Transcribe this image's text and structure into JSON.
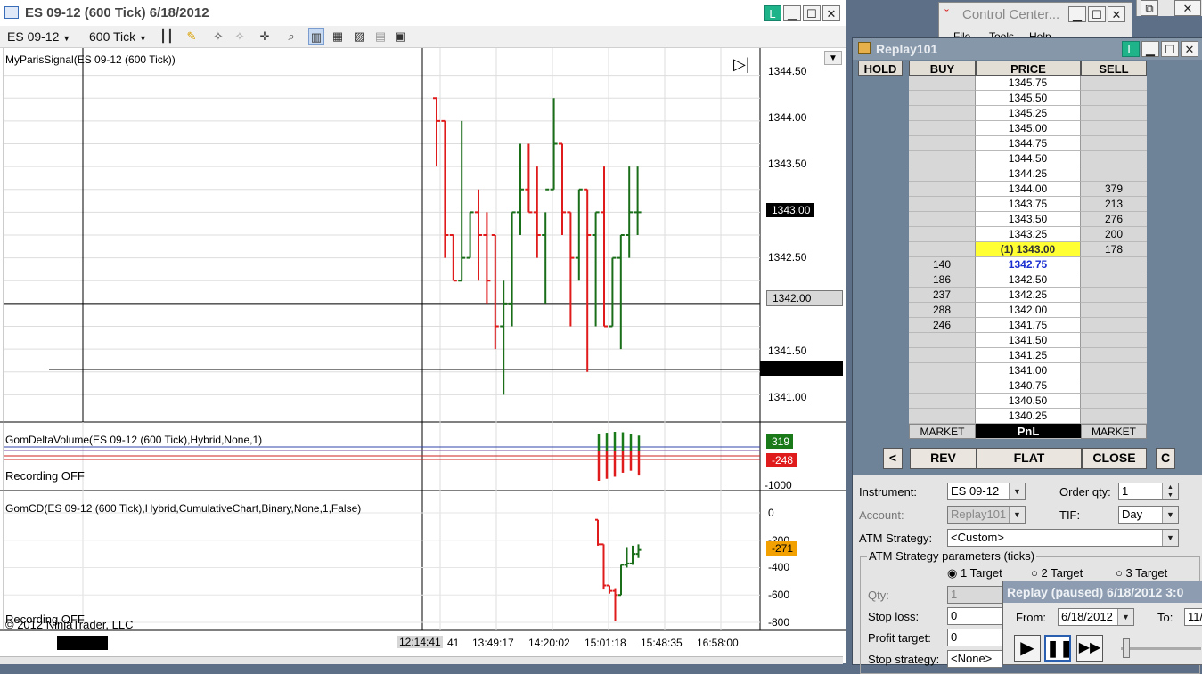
{
  "chart_window": {
    "title": "ES 09-12  (600 Tick)  6/18/2012",
    "toolbar": {
      "instrument": "ES 09-12",
      "period": "600 Tick"
    },
    "panel1_label": "MyParisSignal(ES 09-12 (600 Tick))",
    "panel2_label": "GomDeltaVolume(ES 09-12 (600 Tick),Hybrid,None,1)",
    "panel2_status": "Recording OFF",
    "panel3_label": "GomCD(ES  09-12  (600  Tick),Hybrid,CumulativeChart,Binary,None,1,False)",
    "panel3_status": "Recording OFF",
    "copyright": "© 2012 NinjaTrader, LLC",
    "price_ticks": [
      "1344.50",
      "1344.00",
      "1343.50",
      "1342.50",
      "1341.50",
      "1341.00"
    ],
    "last_price_flag": "1343.00",
    "line_price_flag": "1342.00",
    "delta_flags": {
      "pos": "319",
      "neg": "-248",
      "scale": "-1000"
    },
    "cd_ticks": [
      "0",
      "-200",
      "-400",
      "-600",
      "-800"
    ],
    "cd_flag": "-271",
    "time_ticks": [
      "12:14:41",
      "41",
      "13:49:17",
      "14:20:02",
      "15:01:18",
      "15:48:35",
      "16:58:00"
    ],
    "colors": {
      "up": "#1a6e1a",
      "down": "#e01b1b",
      "last_flag": "#000000",
      "delta_pos": "#1a7a1a",
      "delta_neg": "#e01b1b",
      "cd_flag": "#f2a100"
    }
  },
  "chart_data": [
    {
      "type": "ohlc",
      "series": [
        {
          "o": 1344.25,
          "h": 1344.25,
          "l": 1343.5,
          "c": 1344.0
        },
        {
          "o": 1344.0,
          "h": 1344.0,
          "l": 1342.5,
          "c": 1342.75
        },
        {
          "o": 1342.75,
          "h": 1342.75,
          "l": 1342.25,
          "c": 1342.25
        },
        {
          "o": 1342.25,
          "h": 1344.0,
          "l": 1342.25,
          "c": 1342.5
        },
        {
          "o": 1342.5,
          "h": 1343.0,
          "l": 1342.5,
          "c": 1343.0
        },
        {
          "o": 1343.0,
          "h": 1343.25,
          "l": 1342.25,
          "c": 1342.75
        },
        {
          "o": 1342.75,
          "h": 1343.0,
          "l": 1342.0,
          "c": 1342.25
        },
        {
          "o": 1342.75,
          "h": 1342.75,
          "l": 1341.5,
          "c": 1341.75
        },
        {
          "o": 1341.75,
          "h": 1342.25,
          "l": 1341.0,
          "c": 1342.0
        },
        {
          "o": 1342.0,
          "h": 1343.0,
          "l": 1341.75,
          "c": 1343.0
        },
        {
          "o": 1343.0,
          "h": 1343.75,
          "l": 1342.75,
          "c": 1343.25
        },
        {
          "o": 1343.25,
          "h": 1343.75,
          "l": 1343.0,
          "c": 1343.0
        },
        {
          "o": 1343.0,
          "h": 1343.5,
          "l": 1342.5,
          "c": 1342.75
        },
        {
          "o": 1342.75,
          "h": 1343.0,
          "l": 1342.0,
          "c": 1343.25
        },
        {
          "o": 1343.25,
          "h": 1344.25,
          "l": 1343.25,
          "c": 1343.75
        },
        {
          "o": 1343.75,
          "h": 1343.75,
          "l": 1342.75,
          "c": 1343.0
        },
        {
          "o": 1343.0,
          "h": 1343.0,
          "l": 1341.75,
          "c": 1342.5
        },
        {
          "o": 1342.5,
          "h": 1343.25,
          "l": 1342.25,
          "c": 1343.25
        },
        {
          "o": 1343.25,
          "h": 1343.25,
          "l": 1341.25,
          "c": 1342.75
        },
        {
          "o": 1342.75,
          "h": 1343.0,
          "l": 1341.75,
          "c": 1343.0
        },
        {
          "o": 1343.0,
          "h": 1343.5,
          "l": 1341.75,
          "c": 1341.75
        },
        {
          "o": 1341.75,
          "h": 1342.5,
          "l": 1341.75,
          "c": 1342.5
        },
        {
          "o": 1342.5,
          "h": 1342.75,
          "l": 1341.5,
          "c": 1342.75
        },
        {
          "o": 1342.75,
          "h": 1343.5,
          "l": 1342.5,
          "c": 1343.0
        },
        {
          "o": 1343.0,
          "h": 1343.5,
          "l": 1342.75,
          "c": 1343.0
        }
      ],
      "ylim": [
        1340.75,
        1344.75
      ]
    },
    {
      "type": "bar",
      "values": [
        350,
        -300,
        380,
        -280,
        400,
        -260,
        390,
        -220,
        360,
        -200,
        319,
        -248
      ],
      "ylim": [
        -1000,
        600
      ]
    },
    {
      "type": "ohlc",
      "series": [
        {
          "o": -50,
          "h": -50,
          "l": -240,
          "c": -230
        },
        {
          "o": -230,
          "h": -230,
          "l": -560,
          "c": -530
        },
        {
          "o": -530,
          "h": -530,
          "l": -590,
          "c": -570
        },
        {
          "o": -570,
          "h": -550,
          "l": -790,
          "c": -600
        },
        {
          "o": -600,
          "h": -380,
          "l": -600,
          "c": -380
        },
        {
          "o": -380,
          "h": -250,
          "l": -400,
          "c": -370
        },
        {
          "o": -370,
          "h": -240,
          "l": -380,
          "c": -300
        },
        {
          "o": -300,
          "h": -230,
          "l": -330,
          "c": -271
        }
      ],
      "ylim": [
        -850,
        50
      ]
    }
  ],
  "control_center": {
    "title": "Control Center...",
    "menu": [
      "File",
      "Tools",
      "Help"
    ]
  },
  "dom_window": {
    "title": "Replay101",
    "headers": {
      "hold": "HOLD",
      "buy": "BUY",
      "price": "PRICE",
      "sell": "SELL"
    },
    "rows": [
      {
        "buy": "",
        "price": "1345.75",
        "sell": ""
      },
      {
        "buy": "",
        "price": "1345.50",
        "sell": ""
      },
      {
        "buy": "",
        "price": "1345.25",
        "sell": ""
      },
      {
        "buy": "",
        "price": "1345.00",
        "sell": ""
      },
      {
        "buy": "",
        "price": "1344.75",
        "sell": ""
      },
      {
        "buy": "",
        "price": "1344.50",
        "sell": ""
      },
      {
        "buy": "",
        "price": "1344.25",
        "sell": ""
      },
      {
        "buy": "",
        "price": "1344.00",
        "sell": "379"
      },
      {
        "buy": "",
        "price": "1343.75",
        "sell": "213"
      },
      {
        "buy": "",
        "price": "1343.50",
        "sell": "276"
      },
      {
        "buy": "",
        "price": "1343.25",
        "sell": "200"
      },
      {
        "buy": "",
        "price": "(1) 1343.00",
        "sell": "178"
      },
      {
        "buy": "140",
        "price": "1342.75",
        "sell": ""
      },
      {
        "buy": "186",
        "price": "1342.50",
        "sell": ""
      },
      {
        "buy": "237",
        "price": "1342.25",
        "sell": ""
      },
      {
        "buy": "288",
        "price": "1342.00",
        "sell": ""
      },
      {
        "buy": "246",
        "price": "1341.75",
        "sell": ""
      },
      {
        "buy": "",
        "price": "1341.50",
        "sell": ""
      },
      {
        "buy": "",
        "price": "1341.25",
        "sell": ""
      },
      {
        "buy": "",
        "price": "1341.00",
        "sell": ""
      },
      {
        "buy": "",
        "price": "1340.75",
        "sell": ""
      },
      {
        "buy": "",
        "price": "1340.50",
        "sell": ""
      },
      {
        "buy": "",
        "price": "1340.25",
        "sell": ""
      }
    ],
    "footer": {
      "buy_market": "MARKET",
      "pnl": "PnL",
      "sell_market": "MARKET"
    },
    "buttons": {
      "left": "<",
      "rev": "REV",
      "flat": "FLAT",
      "close": "CLOSE",
      "c": "C"
    },
    "form": {
      "instrument_label": "Instrument:",
      "instrument_value": "ES 09-12",
      "orderqty_label": "Order qty:",
      "orderqty_value": "1",
      "account_label": "Account:",
      "account_value": "Replay101",
      "tif_label": "TIF:",
      "tif_value": "Day",
      "atm_label": "ATM Strategy:",
      "atm_value": "<Custom>",
      "atm_params_label": "ATM Strategy parameters (ticks)",
      "target1": "1 Target",
      "target2": "2 Target",
      "target3": "3 Target",
      "qty_label": "Qty:",
      "qty_value": "1",
      "stoploss_label": "Stop loss:",
      "stoploss_value": "0",
      "profit_label": "Profit target:",
      "profit_value": "0",
      "stopstrat_label": "Stop strategy:",
      "stopstrat_value": "<None>"
    }
  },
  "replay_window": {
    "title": "Replay (paused) 6/18/2012 3:0",
    "from_label": "From:",
    "from_value": "6/18/2012",
    "to_label": "To:",
    "to_value": "11/"
  }
}
